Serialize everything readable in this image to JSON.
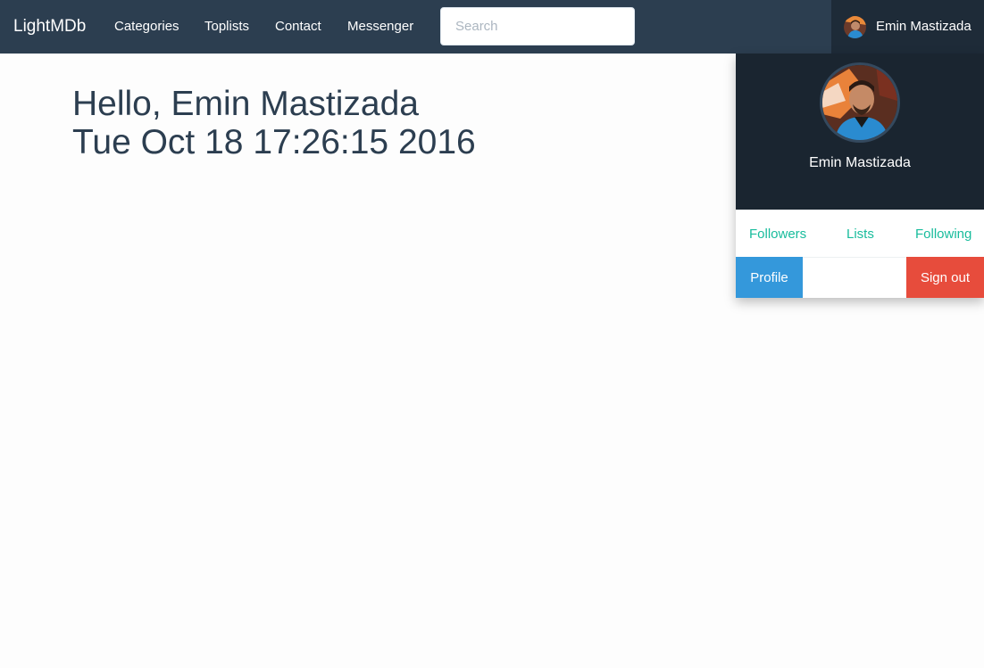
{
  "navbar": {
    "brand": "LightMDb",
    "links": [
      "Categories",
      "Toplists",
      "Contact",
      "Messenger"
    ],
    "search_placeholder": "Search",
    "user_name": "Emin Mastizada"
  },
  "main": {
    "greeting": "Hello, Emin Mastizada",
    "datetime": "Tue Oct 18 17:26:15 2016"
  },
  "user_dropdown": {
    "name": "Emin Mastizada",
    "stats": [
      "Followers",
      "Lists",
      "Following"
    ],
    "profile_button": "Profile",
    "signout_button": "Sign out"
  },
  "colors": {
    "navbar": "#2c3e50",
    "accent_link": "#18bc9c",
    "profile_button": "#3498db",
    "signout_button": "#e74c3c"
  }
}
